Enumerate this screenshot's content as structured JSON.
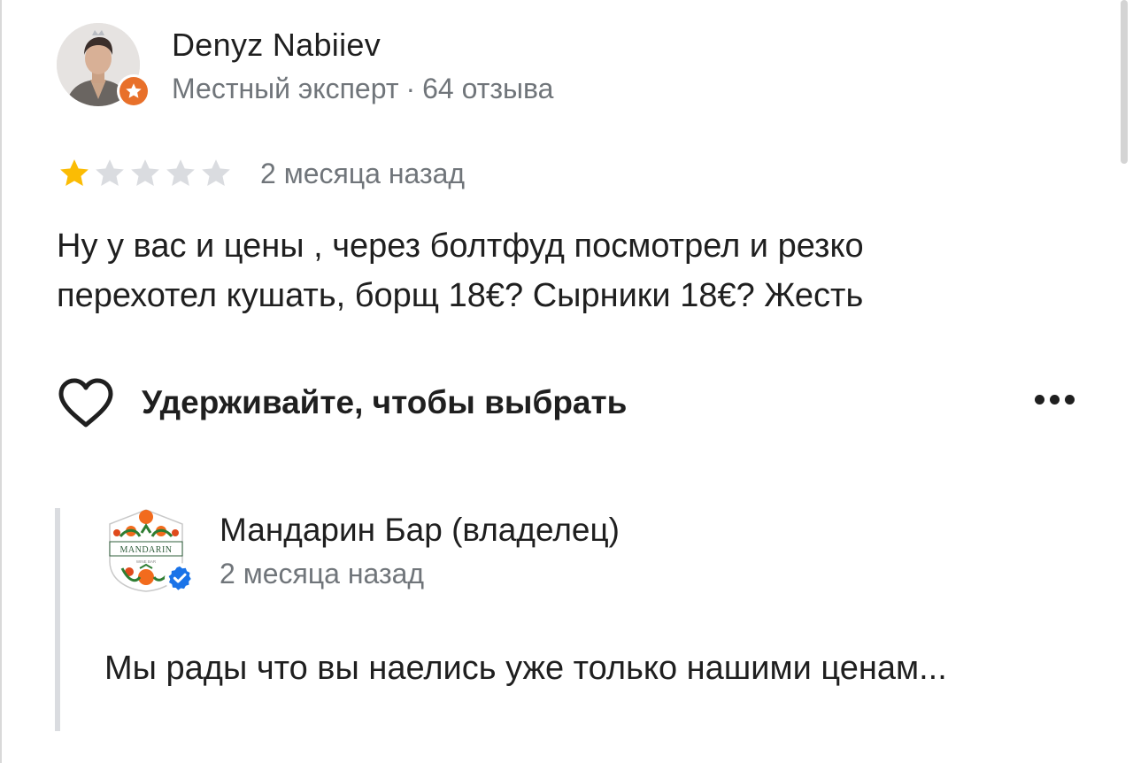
{
  "reviewer": {
    "name": "Denyz Nabiiev",
    "role": "Местный эксперт",
    "separator": "·",
    "reviews_count": "64 отзыва",
    "avatar_icon": "profile-photo",
    "badge_icon": "local-guide-star-icon"
  },
  "review": {
    "rating": 1,
    "max_rating": 5,
    "date": "2 месяца назад",
    "text_lines": [
      "Ну у вас и цены , через болтфуд посмотрел и резко",
      "перехотел кушать, борщ 18€? Сырники 18€? Жесть"
    ]
  },
  "actions": {
    "like_icon": "heart-outline-icon",
    "like_label": "Удерживайте, чтобы выбрать",
    "more_icon": "more-horizontal-icon"
  },
  "owner_reply": {
    "name": "Мандарин Бар (владелец)",
    "date": "2 месяца назад",
    "text": "Мы рады что вы наелись уже только нашими ценам...",
    "logo_text": "MANDARIN",
    "logo_subtext": "WINE BAR",
    "verified_icon": "verified-check-icon"
  },
  "colors": {
    "star_filled": "#fbbc04",
    "star_empty": "#dadce0",
    "badge_orange": "#e8702a",
    "verified_blue": "#1a73e8",
    "secondary_text": "#70757a",
    "primary_text": "#1f1f1f"
  }
}
